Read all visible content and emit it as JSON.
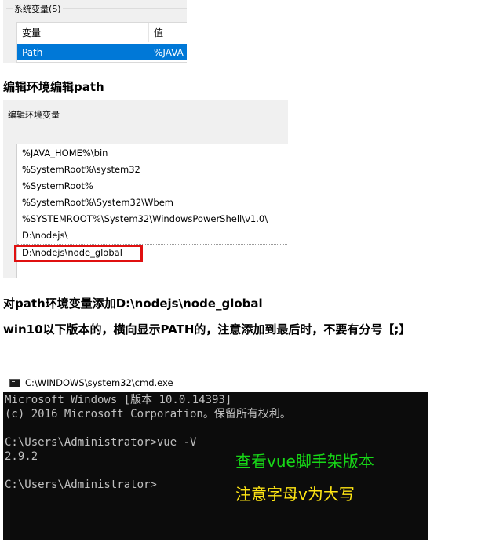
{
  "system_vars": {
    "group_title": "系统变量(S)",
    "col_variable": "变量",
    "col_value": "值",
    "selected_row": {
      "variable": "Path",
      "value": "%JAVA"
    }
  },
  "headings": {
    "edit_path": "编辑环境编辑path",
    "add_path": "对path环境变量添加D:\\nodejs\\node_global",
    "win10_note": "win10以下版本的，横向显示PATH的，注意添加到最后时，不要有分号【;】"
  },
  "edit_env": {
    "dialog_title": "编辑环境变量",
    "entries": [
      "%JAVA_HOME%\\bin",
      "%SystemRoot%\\system32",
      "%SystemRoot%",
      "%SystemRoot%\\System32\\Wbem",
      "%SYSTEMROOT%\\System32\\WindowsPowerShell\\v1.0\\",
      "D:\\nodejs\\",
      "D:\\nodejs\\node_global"
    ]
  },
  "cmd": {
    "window_title": "C:\\WINDOWS\\system32\\cmd.exe",
    "lines": [
      "Microsoft Windows [版本 10.0.14393]",
      "(c) 2016 Microsoft Corporation。保留所有权利。",
      "",
      "C:\\Users\\Administrator>vue -V",
      "2.9.2",
      "",
      "C:\\Users\\Administrator>"
    ],
    "note_green": "查看vue脚手架版本",
    "note_yellow": "注意字母v为大写",
    "colors": {
      "green": "#17d717",
      "yellow": "#ffe614",
      "highlight_box": "#e01010",
      "selection": "#0078d7"
    }
  }
}
